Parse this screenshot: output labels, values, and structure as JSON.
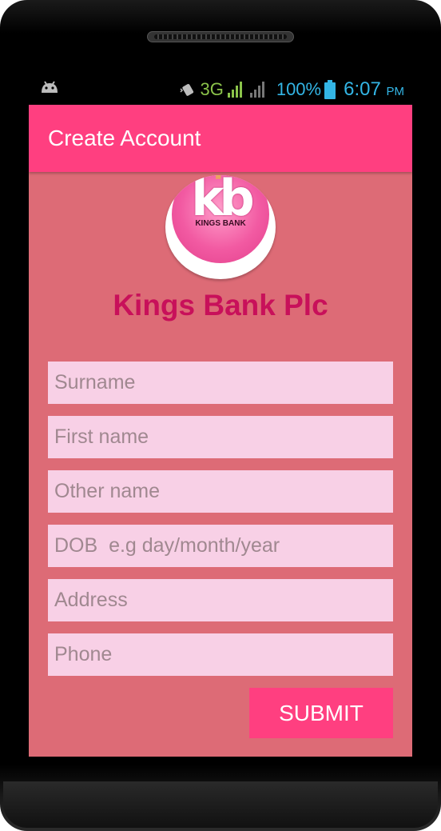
{
  "status_bar": {
    "network": "3G",
    "battery_percent": "100%",
    "time": "6:07",
    "ampm": "PM",
    "icons": [
      "android-debug-icon",
      "vibrate-icon",
      "signal-icon",
      "signal-empty-icon",
      "battery-icon"
    ]
  },
  "appbar": {
    "title": "Create Account"
  },
  "logo": {
    "monogram": "kb",
    "text": "KINGS BANK"
  },
  "bank_name": "Kings Bank Plc",
  "form": {
    "surname_placeholder": "Surname",
    "firstname_placeholder": "First name",
    "othername_placeholder": "Other name",
    "dob_placeholder": "DOB  e.g day/month/year",
    "address_placeholder": "Address",
    "phone_placeholder": "Phone",
    "submit_label": "SUBMIT"
  },
  "colors": {
    "accent": "#ff3f80",
    "background": "#dd6b76",
    "field": "#f8d0e6",
    "title": "#c8105a"
  }
}
